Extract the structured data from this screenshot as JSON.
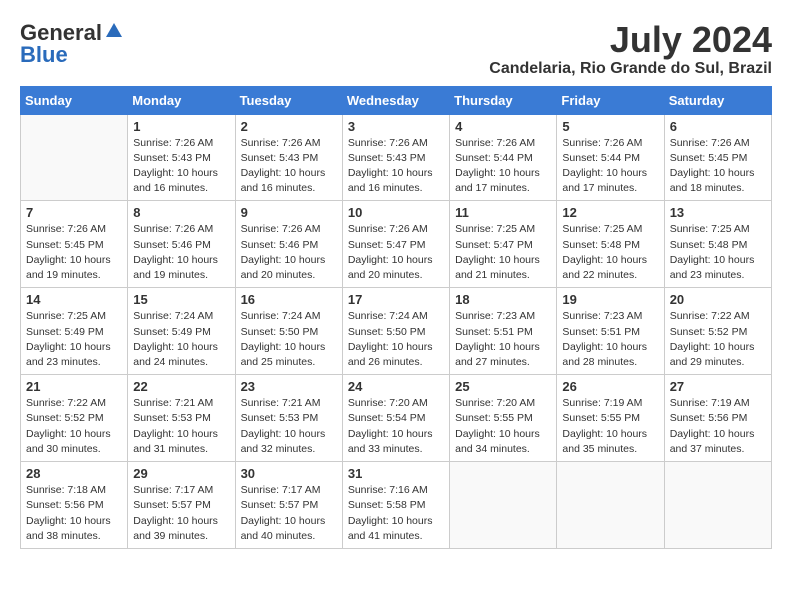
{
  "header": {
    "logo_general": "General",
    "logo_blue": "Blue",
    "month": "July 2024",
    "location": "Candelaria, Rio Grande do Sul, Brazil"
  },
  "weekdays": [
    "Sunday",
    "Monday",
    "Tuesday",
    "Wednesday",
    "Thursday",
    "Friday",
    "Saturday"
  ],
  "weeks": [
    [
      {
        "day": "",
        "sunrise": "",
        "sunset": "",
        "daylight": ""
      },
      {
        "day": "1",
        "sunrise": "Sunrise: 7:26 AM",
        "sunset": "Sunset: 5:43 PM",
        "daylight": "Daylight: 10 hours and 16 minutes."
      },
      {
        "day": "2",
        "sunrise": "Sunrise: 7:26 AM",
        "sunset": "Sunset: 5:43 PM",
        "daylight": "Daylight: 10 hours and 16 minutes."
      },
      {
        "day": "3",
        "sunrise": "Sunrise: 7:26 AM",
        "sunset": "Sunset: 5:43 PM",
        "daylight": "Daylight: 10 hours and 16 minutes."
      },
      {
        "day": "4",
        "sunrise": "Sunrise: 7:26 AM",
        "sunset": "Sunset: 5:44 PM",
        "daylight": "Daylight: 10 hours and 17 minutes."
      },
      {
        "day": "5",
        "sunrise": "Sunrise: 7:26 AM",
        "sunset": "Sunset: 5:44 PM",
        "daylight": "Daylight: 10 hours and 17 minutes."
      },
      {
        "day": "6",
        "sunrise": "Sunrise: 7:26 AM",
        "sunset": "Sunset: 5:45 PM",
        "daylight": "Daylight: 10 hours and 18 minutes."
      }
    ],
    [
      {
        "day": "7",
        "sunrise": "Sunrise: 7:26 AM",
        "sunset": "Sunset: 5:45 PM",
        "daylight": "Daylight: 10 hours and 19 minutes."
      },
      {
        "day": "8",
        "sunrise": "Sunrise: 7:26 AM",
        "sunset": "Sunset: 5:46 PM",
        "daylight": "Daylight: 10 hours and 19 minutes."
      },
      {
        "day": "9",
        "sunrise": "Sunrise: 7:26 AM",
        "sunset": "Sunset: 5:46 PM",
        "daylight": "Daylight: 10 hours and 20 minutes."
      },
      {
        "day": "10",
        "sunrise": "Sunrise: 7:26 AM",
        "sunset": "Sunset: 5:47 PM",
        "daylight": "Daylight: 10 hours and 20 minutes."
      },
      {
        "day": "11",
        "sunrise": "Sunrise: 7:25 AM",
        "sunset": "Sunset: 5:47 PM",
        "daylight": "Daylight: 10 hours and 21 minutes."
      },
      {
        "day": "12",
        "sunrise": "Sunrise: 7:25 AM",
        "sunset": "Sunset: 5:48 PM",
        "daylight": "Daylight: 10 hours and 22 minutes."
      },
      {
        "day": "13",
        "sunrise": "Sunrise: 7:25 AM",
        "sunset": "Sunset: 5:48 PM",
        "daylight": "Daylight: 10 hours and 23 minutes."
      }
    ],
    [
      {
        "day": "14",
        "sunrise": "Sunrise: 7:25 AM",
        "sunset": "Sunset: 5:49 PM",
        "daylight": "Daylight: 10 hours and 23 minutes."
      },
      {
        "day": "15",
        "sunrise": "Sunrise: 7:24 AM",
        "sunset": "Sunset: 5:49 PM",
        "daylight": "Daylight: 10 hours and 24 minutes."
      },
      {
        "day": "16",
        "sunrise": "Sunrise: 7:24 AM",
        "sunset": "Sunset: 5:50 PM",
        "daylight": "Daylight: 10 hours and 25 minutes."
      },
      {
        "day": "17",
        "sunrise": "Sunrise: 7:24 AM",
        "sunset": "Sunset: 5:50 PM",
        "daylight": "Daylight: 10 hours and 26 minutes."
      },
      {
        "day": "18",
        "sunrise": "Sunrise: 7:23 AM",
        "sunset": "Sunset: 5:51 PM",
        "daylight": "Daylight: 10 hours and 27 minutes."
      },
      {
        "day": "19",
        "sunrise": "Sunrise: 7:23 AM",
        "sunset": "Sunset: 5:51 PM",
        "daylight": "Daylight: 10 hours and 28 minutes."
      },
      {
        "day": "20",
        "sunrise": "Sunrise: 7:22 AM",
        "sunset": "Sunset: 5:52 PM",
        "daylight": "Daylight: 10 hours and 29 minutes."
      }
    ],
    [
      {
        "day": "21",
        "sunrise": "Sunrise: 7:22 AM",
        "sunset": "Sunset: 5:52 PM",
        "daylight": "Daylight: 10 hours and 30 minutes."
      },
      {
        "day": "22",
        "sunrise": "Sunrise: 7:21 AM",
        "sunset": "Sunset: 5:53 PM",
        "daylight": "Daylight: 10 hours and 31 minutes."
      },
      {
        "day": "23",
        "sunrise": "Sunrise: 7:21 AM",
        "sunset": "Sunset: 5:53 PM",
        "daylight": "Daylight: 10 hours and 32 minutes."
      },
      {
        "day": "24",
        "sunrise": "Sunrise: 7:20 AM",
        "sunset": "Sunset: 5:54 PM",
        "daylight": "Daylight: 10 hours and 33 minutes."
      },
      {
        "day": "25",
        "sunrise": "Sunrise: 7:20 AM",
        "sunset": "Sunset: 5:55 PM",
        "daylight": "Daylight: 10 hours and 34 minutes."
      },
      {
        "day": "26",
        "sunrise": "Sunrise: 7:19 AM",
        "sunset": "Sunset: 5:55 PM",
        "daylight": "Daylight: 10 hours and 35 minutes."
      },
      {
        "day": "27",
        "sunrise": "Sunrise: 7:19 AM",
        "sunset": "Sunset: 5:56 PM",
        "daylight": "Daylight: 10 hours and 37 minutes."
      }
    ],
    [
      {
        "day": "28",
        "sunrise": "Sunrise: 7:18 AM",
        "sunset": "Sunset: 5:56 PM",
        "daylight": "Daylight: 10 hours and 38 minutes."
      },
      {
        "day": "29",
        "sunrise": "Sunrise: 7:17 AM",
        "sunset": "Sunset: 5:57 PM",
        "daylight": "Daylight: 10 hours and 39 minutes."
      },
      {
        "day": "30",
        "sunrise": "Sunrise: 7:17 AM",
        "sunset": "Sunset: 5:57 PM",
        "daylight": "Daylight: 10 hours and 40 minutes."
      },
      {
        "day": "31",
        "sunrise": "Sunrise: 7:16 AM",
        "sunset": "Sunset: 5:58 PM",
        "daylight": "Daylight: 10 hours and 41 minutes."
      },
      {
        "day": "",
        "sunrise": "",
        "sunset": "",
        "daylight": ""
      },
      {
        "day": "",
        "sunrise": "",
        "sunset": "",
        "daylight": ""
      },
      {
        "day": "",
        "sunrise": "",
        "sunset": "",
        "daylight": ""
      }
    ]
  ]
}
